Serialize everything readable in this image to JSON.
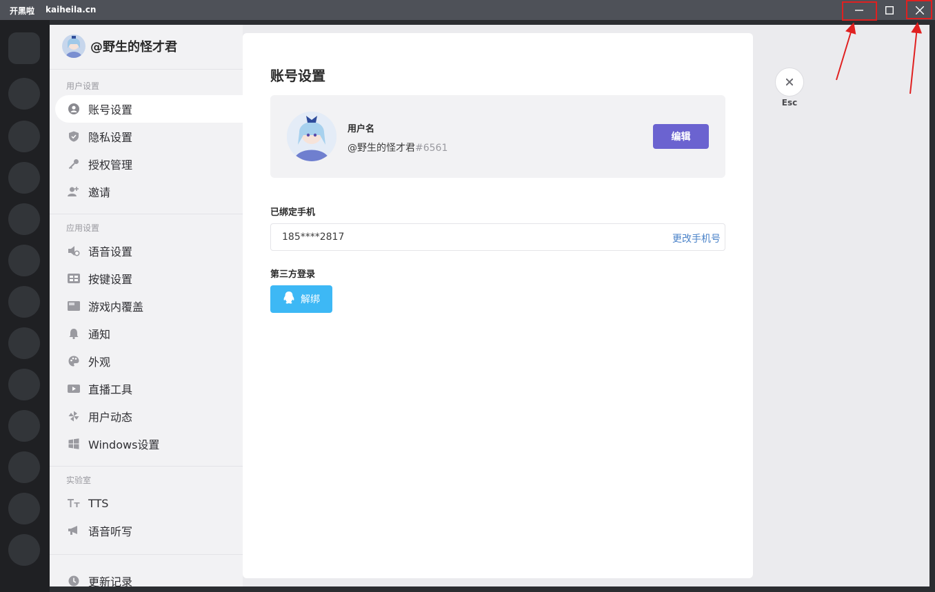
{
  "titlebar": {
    "app_name": "开黑啦",
    "domain": "kaiheila.cn"
  },
  "window_controls": {
    "minimize": "minimize-icon",
    "maximize": "maximize-icon",
    "close": "close-icon"
  },
  "sidebar": {
    "username": "@野生的怪才君",
    "sections": [
      {
        "title": "用户设置",
        "items": [
          {
            "label": "账号设置",
            "icon": "user-icon",
            "active": true
          },
          {
            "label": "隐私设置",
            "icon": "shield-icon"
          },
          {
            "label": "授权管理",
            "icon": "key-icon"
          },
          {
            "label": "邀请",
            "icon": "add-user-icon"
          }
        ]
      },
      {
        "title": "应用设置",
        "items": [
          {
            "label": "语音设置",
            "icon": "speaker-gear-icon"
          },
          {
            "label": "按键设置",
            "icon": "keyboard-icon"
          },
          {
            "label": "游戏内覆盖",
            "icon": "overlay-icon"
          },
          {
            "label": "通知",
            "icon": "bell-icon"
          },
          {
            "label": "外观",
            "icon": "palette-icon"
          },
          {
            "label": "直播工具",
            "icon": "video-icon"
          },
          {
            "label": "用户动态",
            "icon": "pinwheel-icon"
          },
          {
            "label": "Windows设置",
            "icon": "windows-icon"
          }
        ]
      },
      {
        "title": "实验室",
        "items": [
          {
            "label": "TTS",
            "icon": "text-size-icon"
          },
          {
            "label": "语音听写",
            "icon": "megaphone-icon"
          }
        ]
      }
    ],
    "footer_item": {
      "label": "更新记录",
      "icon": "clock-icon"
    }
  },
  "content": {
    "title": "账号设置",
    "profile": {
      "label": "用户名",
      "name": "@野生的怪才君",
      "tag": "#6561",
      "edit_button": "编辑"
    },
    "phone": {
      "label": "已绑定手机",
      "value": "185****2817",
      "change_link": "更改手机号"
    },
    "third_party": {
      "label": "第三方登录",
      "unbind_button": "解绑",
      "provider_icon": "qq-icon"
    }
  },
  "esc": {
    "label": "Esc",
    "icon": "close-icon"
  },
  "colors": {
    "accent_purple": "#6b63d0",
    "qq_blue": "#3db8f5",
    "link_blue": "#4a82c8",
    "annotation_red": "#e02020"
  }
}
